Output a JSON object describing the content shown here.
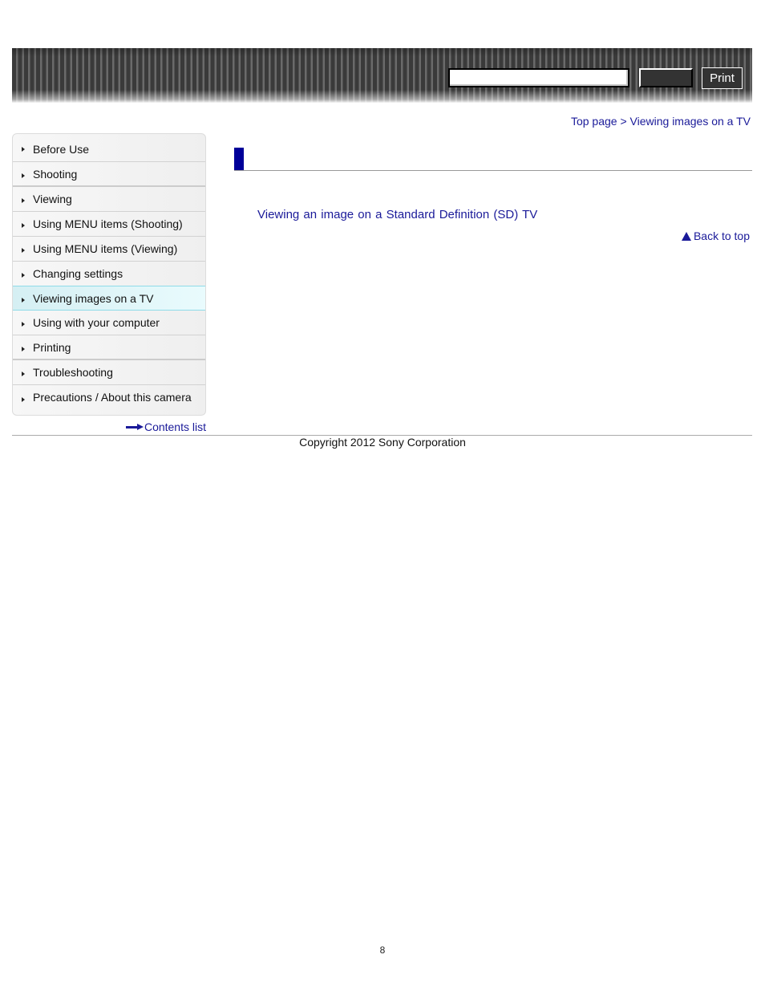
{
  "header": {
    "search_placeholder": "",
    "search_button_label": "",
    "print_label": "Print"
  },
  "breadcrumb": {
    "items": [
      "Top page",
      "Viewing images on a TV"
    ],
    "separator": " > "
  },
  "sidebar": {
    "items": [
      {
        "label": "Before Use"
      },
      {
        "label": "Shooting"
      },
      {
        "label": "Viewing"
      },
      {
        "label": "Using MENU items (Shooting)"
      },
      {
        "label": "Using MENU items (Viewing)"
      },
      {
        "label": "Changing settings"
      },
      {
        "label": "Viewing images on a TV",
        "active": true
      },
      {
        "label": "Using with your computer"
      },
      {
        "label": "Printing"
      },
      {
        "label": "Troubleshooting"
      },
      {
        "label": "Precautions / About this camera"
      }
    ],
    "contents_list_label": "Contents list"
  },
  "main": {
    "title": "",
    "topic_links": [
      "Viewing an image on a Standard Definition (SD) TV"
    ],
    "back_to_top_label": "Back to top"
  },
  "footer": {
    "copyright": "Copyright 2012 Sony Corporation",
    "page_number": "8"
  },
  "colors": {
    "link": "#1a1a99",
    "title_accent": "#000099",
    "active_nav_bg": "#d5eff3"
  }
}
